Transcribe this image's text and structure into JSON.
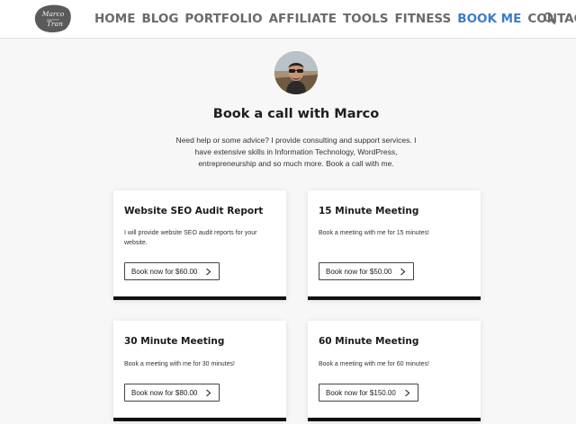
{
  "header": {
    "logo_text": "Marco Tran",
    "nav": [
      {
        "label": "HOME",
        "active": false
      },
      {
        "label": "BLOG",
        "active": false
      },
      {
        "label": "PORTFOLIO",
        "active": false
      },
      {
        "label": "AFFILIATE",
        "active": false
      },
      {
        "label": "TOOLS",
        "active": false
      },
      {
        "label": "FITNESS",
        "active": false
      },
      {
        "label": "BOOK ME",
        "active": true
      },
      {
        "label": "CONTACT",
        "active": false
      }
    ],
    "search_icon": "search-icon"
  },
  "profile": {
    "title": "Book a call with Marco",
    "intro": "Need help or some advice? I provide consulting and support services. I have extensive skills in Information Technology, WordPress, entrepreneurship and so much more. Book a call with me."
  },
  "cards": [
    {
      "title": "Website SEO Audit Report",
      "description": "I will provide website SEO audit reports for your website.",
      "button": "Book now for $60.00"
    },
    {
      "title": "15 Minute Meeting",
      "description": "Book a meeting with me for 15 minutes!",
      "button": "Book now for $50.00"
    },
    {
      "title": "30 Minute Meeting",
      "description": "Book a meeting with me for 30 minutes!",
      "button": "Book now for $80.00"
    },
    {
      "title": "60 Minute Meeting",
      "description": "Book a meeting with me for 60 minutes!",
      "button": "Book now for $150.00"
    }
  ],
  "colors": {
    "accent": "#3f7bc9",
    "nav_text": "#6a6a6a",
    "card_border": "#111111",
    "background": "#f7f7f7"
  }
}
